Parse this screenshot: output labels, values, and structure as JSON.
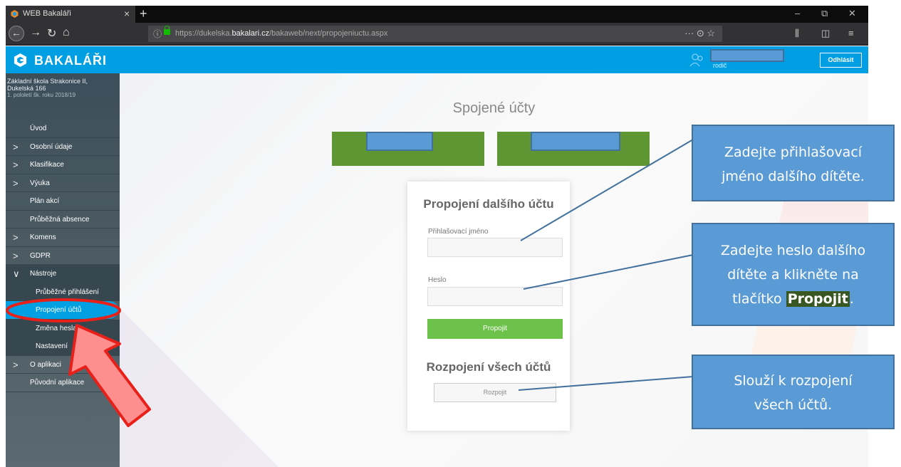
{
  "browser": {
    "tab_title": "WEB Bakaláři",
    "url_host_prefix": "https://dukelska.",
    "url_host_domain": "bakalari.cz",
    "url_path": "/bakaweb/next/propojeniuctu.aspx"
  },
  "header": {
    "brand": "BAKALÁŘI",
    "user_role": "rodič",
    "logout_label": "Odhlásit"
  },
  "sidebar": {
    "school_line1": "Základní škola Strakonice II,",
    "school_line2": "Dukelská 166",
    "term": "1. pololetí šk. roku 2018/19",
    "items": [
      {
        "label": "Úvod",
        "chevron": ""
      },
      {
        "label": "Osobní údaje",
        "chevron": ">"
      },
      {
        "label": "Klasifikace",
        "chevron": ">"
      },
      {
        "label": "Výuka",
        "chevron": ">"
      },
      {
        "label": "Plán akcí",
        "chevron": ""
      },
      {
        "label": "Průběžná absence",
        "chevron": ""
      },
      {
        "label": "Komens",
        "chevron": ">"
      },
      {
        "label": "GDPR",
        "chevron": ">"
      },
      {
        "label": "Nástroje",
        "chevron": "∨"
      },
      {
        "label": "Průběžné přihlášení",
        "chevron": ""
      },
      {
        "label": "Propojení účtů",
        "chevron": ""
      },
      {
        "label": "Změna hesla",
        "chevron": ""
      },
      {
        "label": "Nastavení",
        "chevron": ""
      },
      {
        "label": "O aplikaci",
        "chevron": ">"
      },
      {
        "label": "Původní aplikace",
        "chevron": ""
      }
    ]
  },
  "main": {
    "page_title": "Spojené účty",
    "link_heading": "Propojení dalšího účtu",
    "username_label": "Přihlašovací jméno",
    "username_value": "",
    "password_label": "Heslo",
    "password_value": "",
    "link_button": "Propojit",
    "unlink_heading": "Rozpojení všech účtů",
    "unlink_button": "Rozpojit"
  },
  "callouts": {
    "username_line1": "Zadejte přihlašovací",
    "username_line2": "jméno dalšího dítěte.",
    "password_line1": "Zadejte heslo dalšího",
    "password_line2": "dítěte a klikněte na",
    "password_line3_prefix": "tlačítko ",
    "password_line3_keyword": "Propojit",
    "password_line3_suffix": ".",
    "unlink_line1": "Slouží k rozpojení",
    "unlink_line2": "všech účtů."
  },
  "colors": {
    "brand": "#009fe3",
    "account_tile": "#5d9632",
    "link_button": "#6cc24a",
    "callout": "#5b9bd5",
    "highlight_ring": "#e8201a"
  }
}
